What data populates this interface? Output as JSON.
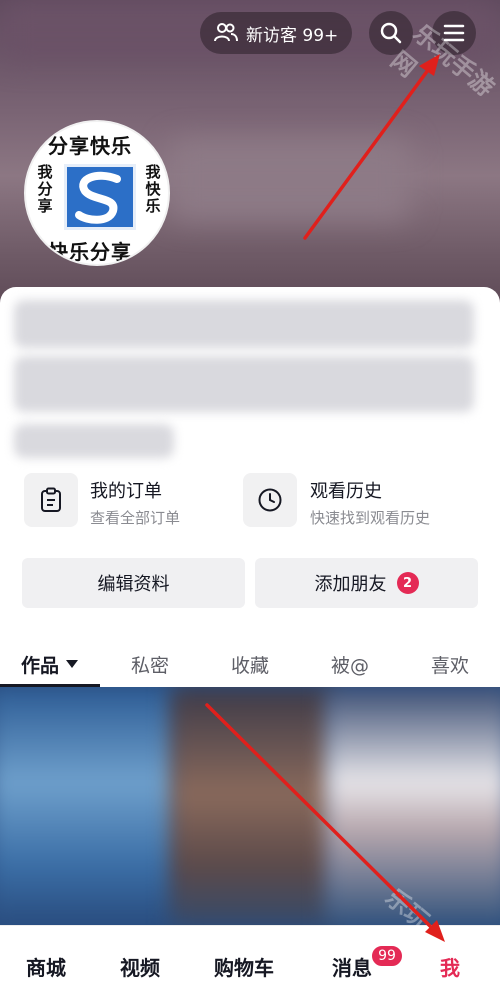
{
  "header": {
    "visitor_label": "新访客 99+"
  },
  "avatar": {
    "top_text": "分享快乐",
    "bottom_text": "快乐分享",
    "left_text": "我分享",
    "right_text": "我快乐"
  },
  "cards": [
    {
      "title": "我的订单",
      "subtitle": "查看全部订单",
      "icon": "clipboard-icon"
    },
    {
      "title": "观看历史",
      "subtitle": "快速找到观看历史",
      "icon": "clock-icon"
    }
  ],
  "actions": {
    "edit_profile": "编辑资料",
    "add_friends": "添加朋友",
    "add_friends_badge": "2"
  },
  "tabs": [
    {
      "label": "作品"
    },
    {
      "label": "私密"
    },
    {
      "label": "收藏"
    },
    {
      "label": "被@"
    },
    {
      "label": "喜欢"
    }
  ],
  "bottom_nav": {
    "items": [
      "商城",
      "视频",
      "购物车",
      "消息",
      "我"
    ],
    "messages_badge": "99"
  },
  "watermark": {
    "top": "乐玩手游网",
    "bottom": "乐玩"
  },
  "colors": {
    "accent": "#e42a55",
    "annotation_arrow": "#e0201c"
  }
}
